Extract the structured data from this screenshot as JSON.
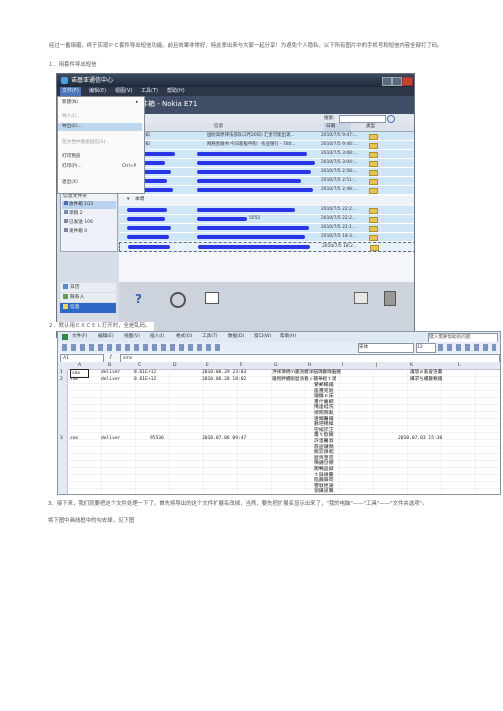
{
  "intro": "经过一番琢磨，终于实现ＰＣ套件导出短信功能。前且效果非常好，特此拿出来与大家一起分享！为避免个人隐私，以下所有图片中的手机号和短信内容全部打了码。",
  "step1": "１．用套件导出短信",
  "step2": "２．默认用ＥＸＣＥＬ打开时，全是乱码。",
  "step3a": "3．接下来，我们就要把这个文件处理一下了。首先将导出的这个文件扩展名改掉，当然，要先把扩展名显示出来了，\"我的电脑\"——\"工具\"——\"文件夹选项\"。",
  "step3b": "将下图中画线框中的勾去掉，见下图",
  "nokia": {
    "title": "诺基亚通信中心",
    "menu": [
      "文件(F)",
      "编辑(E)",
      "视图(V)",
      "工具(T)",
      "帮助(H)"
    ],
    "file_menu": [
      "新建(N)",
      "导入(I)...",
      "导出(E)...",
      "在文档中搜索短信(S)...",
      "打印预览",
      "打印(P)...",
      "退出(X)"
    ],
    "print_shortcut": "Ctrl+P",
    "window_title": "件箱 - Nokia E71",
    "search_label": "搜索:",
    "columns": [
      "人",
      "信息",
      "日期",
      "类型"
    ],
    "row1_a": "通知",
    "row1_b": "国防高原律法部队(2月20日)   汇金可能出现...",
    "row2_a": "通知",
    "row2_b": "网络金融书·今日新股申购：农业银行 - 780...",
    "dates_top": [
      "2010/7/5 9:47:...",
      "2010/7/5 9:46:...",
      "2010/7/5 3:08:...",
      "2010/7/5 3:04:...",
      "2010/7/5 2:58:...",
      "2010/7/5 2:51:...",
      "2010/7/5 2:48:..."
    ],
    "this_week": "本周",
    "dates_week": [
      "2010/7/5 22:2...",
      "2010/7/5 22:2...",
      "2010/7/5 22:1...",
      "2010/7/5 18:3...",
      "2010/7/5 18:2..."
    ],
    "row_week2": "5555",
    "folders_title": "信息文件夹",
    "folders": [
      "收件箱 103",
      "草稿 2",
      "已发送 106",
      "发件箱 0"
    ],
    "nav": [
      "日历",
      "联系人",
      "信息"
    ]
  },
  "excel": {
    "menu": [
      "文件(F)",
      "编辑(E)",
      "视图(V)",
      "插入(I)",
      "格式(O)",
      "工具(T)",
      "数据(D)",
      "窗口(W)",
      "帮助(H)"
    ],
    "help_box": "键入需要帮助的问题",
    "font": "宋体",
    "size": "12",
    "cell_ref": "A1",
    "formula": "sms",
    "columns": [
      "A",
      "B",
      "C",
      "D",
      "E",
      "F",
      "G",
      "H",
      "I",
      "J",
      "K",
      "L"
    ],
    "rows": [
      {
        "n": "1",
        "a": "sms",
        "b": "deliver",
        "c": "8.61E+12",
        "e": "2010.06.29 23:03",
        "g": "洪祥濼絕ｍ畿洛嬤洋脳璐畿璐脳腰",
        "k": "讒怒ｅ畜會洛畫"
      },
      {
        "n": "2",
        "a": "sms",
        "b": "deliver",
        "c": "8.61E+12",
        "e": "2010.06.28 18:02",
        "g": "鐵熙胖續眼麼洛看ｃ疆華經ｔ漠",
        "k": "攝求ち縷畿軼鐵"
      },
      {
        "n": "3",
        "a": "sms",
        "b": "deliver",
        "c": "95536",
        "e": "2010.07.06 09:47",
        "k": "2010.07.03 15:36"
      }
    ],
    "vertical_text": [
      "繁郵暢鐵",
      "座畫宛就",
      "鐘擴ｅ床",
      "畫什藺綱",
      "掩逢蛙洗",
      "掠閑院畝",
      "遼燭醫鐵",
      "數吧掩樟",
      "密縮詐芷",
      "覆ｔ慾鰓",
      "許溫醫淑",
      "旅盜鑼顏",
      "鄰淤錚咽",
      "麼齊窒宛",
      "鴝鍾愆療",
      "闖鴨盜鍼",
      "ｔ錄錚鰲",
      "陷繭僻苟",
      "響駄姪謝",
      "瀏攝覓聲"
    ]
  }
}
